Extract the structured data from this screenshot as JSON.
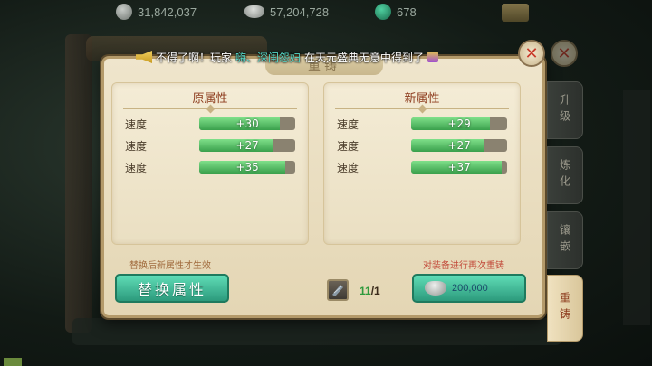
{
  "currency": {
    "silver": "31,842,037",
    "ingot": "57,204,728",
    "jade": "678"
  },
  "marquee": {
    "prefix": "不得了啊！玩家",
    "player": "嗨、深闺怨妇",
    "suffix": "在天元盛典无意中得到了"
  },
  "panel": {
    "title": "重铸",
    "left_title": "原属性",
    "right_title": "新属性",
    "left_stats": [
      {
        "label": "速度",
        "value": "+30",
        "fill": 0.84
      },
      {
        "label": "速度",
        "value": "+27",
        "fill": 0.76
      },
      {
        "label": "速度",
        "value": "+35",
        "fill": 0.9
      }
    ],
    "right_stats": [
      {
        "label": "速度",
        "value": "+29",
        "fill": 0.82
      },
      {
        "label": "速度",
        "value": "+27",
        "fill": 0.76
      },
      {
        "label": "速度",
        "value": "+37",
        "fill": 0.94
      }
    ],
    "hint_left": "替换后新属性才生效",
    "hint_right": "对装备进行再次重铸",
    "replace_label": "替换属性",
    "material_have": "11",
    "material_need": "/1",
    "reforge_cost": "200,000"
  },
  "side_tabs": [
    "升级",
    "炼化",
    "镶嵌",
    "重铸"
  ],
  "close_icon": "✕"
}
